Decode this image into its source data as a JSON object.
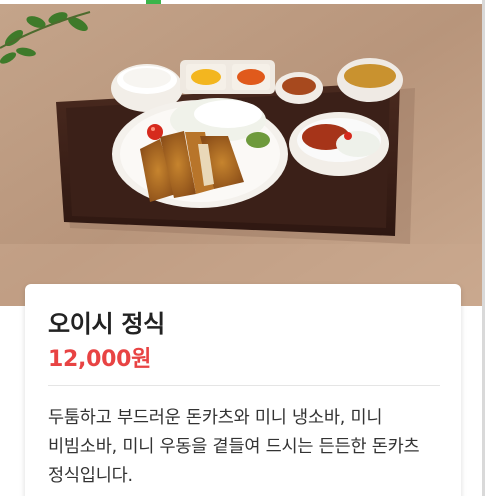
{
  "menu_item": {
    "name": "오이시 정식",
    "price": "12,000원",
    "description": "두툼하고 부드러운 돈카츠와 미니 냉소바, 미니 비빔소바, 미니 우동을 곁들여 드시는 든든한 돈카츠 정식입니다."
  },
  "colors": {
    "price": "#e84343",
    "accent": "#3bb54a",
    "background": "#ffffff"
  },
  "icons": {
    "photo": "tonkatsu-set-meal-photo"
  }
}
